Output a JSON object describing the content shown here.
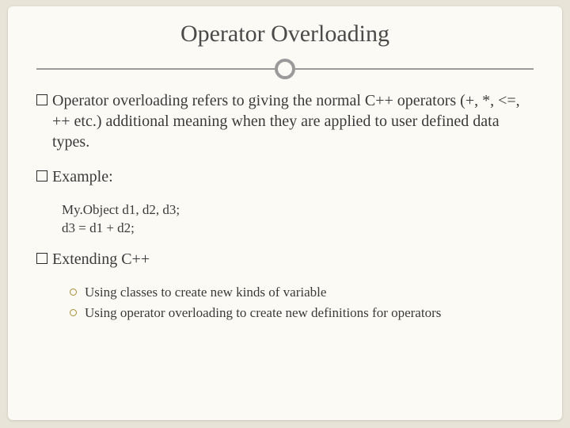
{
  "title": "Operator Overloading",
  "points": [
    {
      "text": "Operator overloading refers to giving the normal C++ operators (+, *, <=, ++ etc.) additional meaning when they are applied to user defined data types."
    },
    {
      "text": "Example:",
      "sub": [
        "My.Object d1, d2, d3;",
        "d3 = d1 + d2;"
      ]
    },
    {
      "text": "Extending C++",
      "list": [
        "Using classes to create new kinds of variable",
        "Using operator overloading to create new definitions for operators"
      ]
    }
  ]
}
